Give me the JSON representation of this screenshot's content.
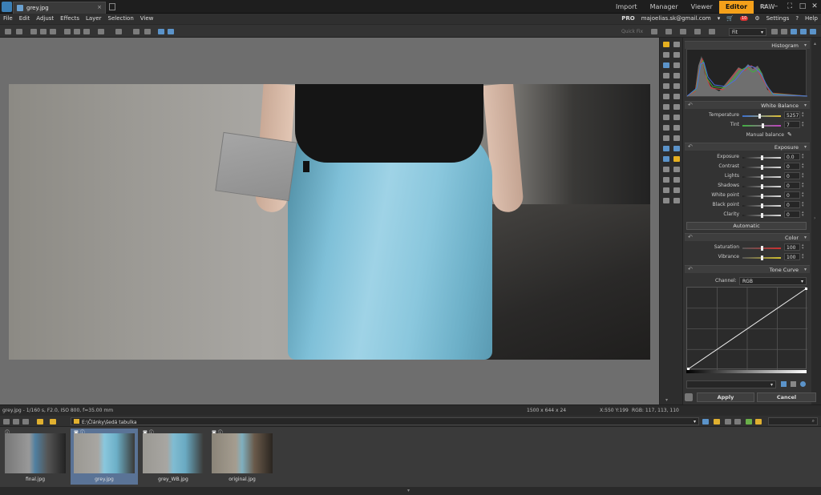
{
  "titlebar": {
    "tab_title": "grey.jpg",
    "modes": [
      "Import",
      "Manager",
      "Viewer",
      "Editor",
      "RAW"
    ],
    "active_mode": "Editor"
  },
  "menu": {
    "items": [
      "File",
      "Edit",
      "Adjust",
      "Effects",
      "Layer",
      "Selection",
      "View"
    ],
    "pro": "PRO",
    "account": "majoelias.sk@gmail.com",
    "cart_badge": "10",
    "settings": "Settings",
    "help": "Help"
  },
  "toolbar": {
    "quickfix": "Quick Fix",
    "zoom": "Fit"
  },
  "panel": {
    "histogram_title": "Histogram",
    "white_balance": {
      "title": "White Balance",
      "temperature_label": "Temperature",
      "temperature_value": "5257",
      "tint_label": "Tint",
      "tint_value": "7",
      "manual": "Manual balance"
    },
    "exposure": {
      "title": "Exposure",
      "rows": [
        {
          "label": "Exposure",
          "value": "0.0"
        },
        {
          "label": "Contrast",
          "value": "0"
        },
        {
          "label": "Lights",
          "value": "0"
        },
        {
          "label": "Shadows",
          "value": "0"
        },
        {
          "label": "White point",
          "value": "0"
        },
        {
          "label": "Black point",
          "value": "0"
        },
        {
          "label": "Clarity",
          "value": "0"
        }
      ],
      "automatic": "Automatic"
    },
    "color": {
      "title": "Color",
      "saturation_label": "Saturation",
      "saturation_value": "100",
      "vibrance_label": "Vibrance",
      "vibrance_value": "100"
    },
    "tone_curve": {
      "title": "Tone Curve",
      "channel_label": "Channel:",
      "channel_value": "RGB"
    },
    "apply": "Apply",
    "cancel": "Cancel"
  },
  "status": {
    "info": "grey.jpg - 1/160 s, F2.0, ISO 800, f=35.00 mm",
    "size": "1500 x 644 x 24",
    "coords": "X:550 Y:199",
    "rgb": "RGB: 117, 113, 110"
  },
  "browser": {
    "path": "E:\\Články\\šedá tabulka"
  },
  "filmstrip": {
    "items": [
      {
        "name": "final.jpg"
      },
      {
        "name": "grey.jpg"
      },
      {
        "name": "grey_WB.jpg"
      },
      {
        "name": "original.jpg"
      }
    ],
    "selected_index": 1
  },
  "colors": {
    "accent": "#f4a01a",
    "selection": "#5a7396"
  }
}
